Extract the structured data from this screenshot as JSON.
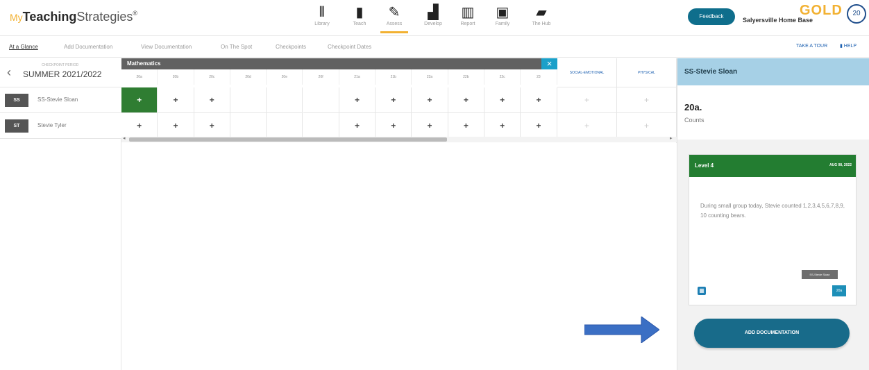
{
  "header": {
    "logo_my": "My",
    "logo_teaching": "Teaching",
    "logo_strategies": "Strategies",
    "logo_tm": "®",
    "gold": "GOLD",
    "home_base": "Salyersville Home Base",
    "gold_badge": "20",
    "feedback": "Feedback"
  },
  "nav": [
    {
      "label": "Library",
      "icon": "library-icon",
      "glyph": "⫴"
    },
    {
      "label": "Teach",
      "icon": "teach-icon",
      "glyph": "▮"
    },
    {
      "label": "Assess",
      "icon": "assess-icon",
      "glyph": "✎"
    },
    {
      "label": "Develop",
      "icon": "develop-icon",
      "glyph": "▟"
    },
    {
      "label": "Report",
      "icon": "report-icon",
      "glyph": "▥"
    },
    {
      "label": "Family",
      "icon": "family-icon",
      "glyph": "▣"
    },
    {
      "label": "The Hub",
      "icon": "hub-icon",
      "glyph": "▰"
    }
  ],
  "subnav": {
    "links": [
      "At a Glance",
      "Add Documentation",
      "View Documentation",
      "On The Spot",
      "Checkpoints",
      "Checkpoint Dates"
    ],
    "take_tour": "TAKE A TOUR",
    "help": "HELP"
  },
  "period": {
    "label": "CHECKPOINT PERIOD",
    "value": "SUMMER 2021/2022"
  },
  "students": [
    {
      "initials": "SS",
      "name": "SS-Stevie Sloan"
    },
    {
      "initials": "ST",
      "name": "Stevie Tyler"
    }
  ],
  "grid": {
    "title": "Mathematics",
    "close": "×",
    "columns": [
      "20a",
      "20b",
      "20c",
      "20d",
      "20e",
      "20f",
      "21a",
      "21b",
      "22a",
      "22b",
      "22c",
      "23"
    ],
    "domains": [
      "SOCIAL-EMOTIONAL",
      "PHYSICAL"
    ],
    "rows": [
      {
        "cells": [
          "+",
          "+",
          "+",
          "",
          "",
          "",
          "+",
          "+",
          "+",
          "+",
          "+",
          "+"
        ],
        "selected": 0
      },
      {
        "cells": [
          "+",
          "+",
          "+",
          "",
          "",
          "",
          "+",
          "+",
          "+",
          "+",
          "+",
          "+"
        ],
        "selected": -1
      }
    ],
    "dim_cell": "+"
  },
  "panel": {
    "student": "SS-Stevie Sloan",
    "code": "20a.",
    "subtitle": "Counts",
    "level": "Level 4",
    "date": "AUG 08, 2022",
    "note": "During small group today, Stevie counted 1,2,3,4,5,6,7,8,9, 10 counting bears.",
    "badge_student": "SS-Stevie Sloan",
    "badge_code": "20a",
    "add_button": "ADD DOCUMENTATION"
  },
  "colors": {
    "accent": "#186b8a",
    "selected": "#2f7d32",
    "header_blue": "#a6d0e6",
    "arrow": "#3b6fc4"
  }
}
